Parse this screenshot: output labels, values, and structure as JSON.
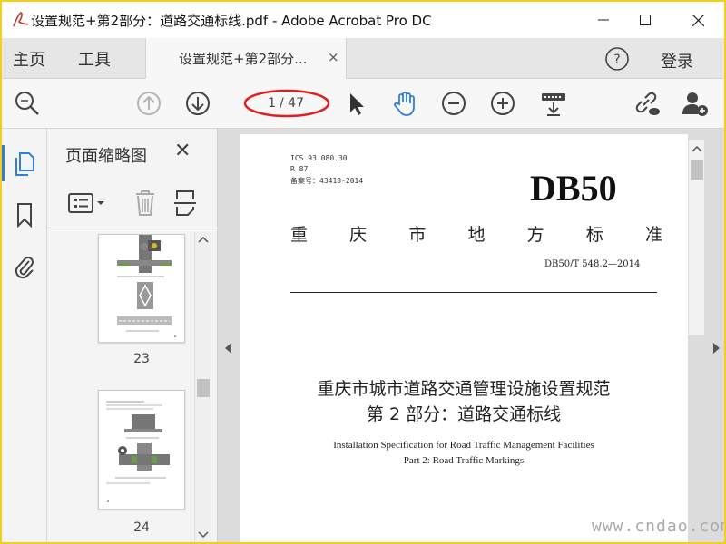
{
  "window": {
    "title": "设置规范+第2部分：道路交通标线.pdf - Adobe Acrobat Pro DC",
    "app_icon": "acrobat-icon"
  },
  "menu": {
    "home": "主页",
    "tools": "工具",
    "doc_tab": "设置规范+第2部分...",
    "doc_tab_close": "×",
    "login": "登录"
  },
  "toolbar": {
    "page_current": "1",
    "page_total": "/ 47",
    "icons": [
      "zoom-search-icon",
      "page-up-icon",
      "page-down-icon",
      "select-cursor-icon",
      "hand-tool-icon",
      "zoom-out-icon",
      "zoom-in-icon",
      "scroll-mode-icon",
      "share-link-icon",
      "add-user-icon"
    ]
  },
  "rail": {
    "icons": [
      "page-thumbnails-icon",
      "bookmark-icon",
      "attachment-icon"
    ]
  },
  "thumbnails": {
    "title": "页面缩略图",
    "close": "✕",
    "pages": [
      {
        "label": "23"
      },
      {
        "label": "24"
      }
    ]
  },
  "document": {
    "ics": "ICS 93.080.30",
    "r": "R 87",
    "record": "备案号：43418-2014",
    "code": "DB50",
    "standard_chars": [
      "重",
      "庆",
      "市",
      "地",
      "方",
      "标",
      "准"
    ],
    "standard_no": "DB50/T 548.2—2014",
    "title_cn_1": "重庆市城市道路交通管理设施设置规范",
    "title_cn_2": "第 2 部分：道路交通标线",
    "title_en_1": "Installation Specification for Road Traffic Management Facilities",
    "title_en_2": "Part 2: Road Traffic Markings"
  },
  "watermark": "www.cndao.com",
  "colors": {
    "accent_blue": "#2f7fd6",
    "annotation_red": "#e02020",
    "border_yellow": "#f2cf1e"
  }
}
